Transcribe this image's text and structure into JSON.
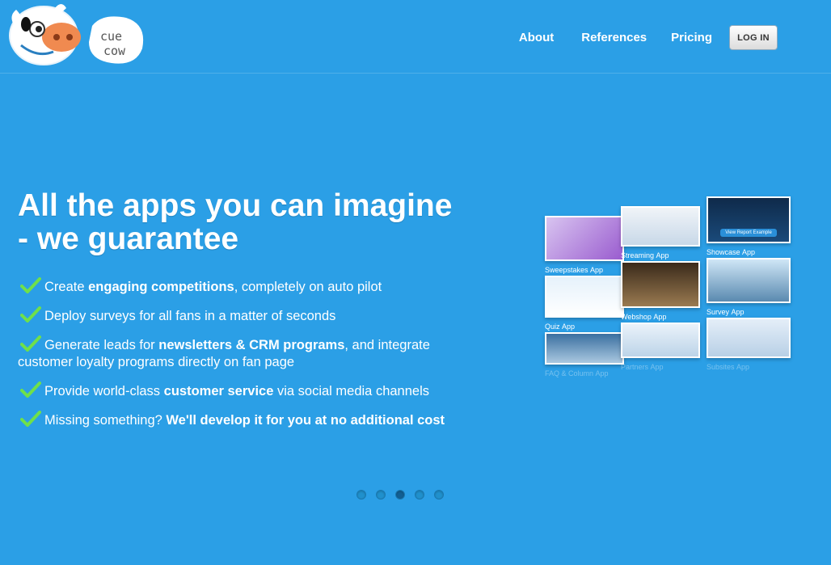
{
  "brand": {
    "logo_text_line1": "cue",
    "logo_text_line2": "cow"
  },
  "nav": {
    "items": [
      "About",
      "References",
      "Pricing"
    ],
    "login_label": "LOG IN"
  },
  "hero": {
    "title_line1": "All the apps you can imagine",
    "title_line2": "- we guarantee",
    "features": [
      {
        "before": "Create ",
        "bold": "engaging competitions",
        "after": ", completely on auto pilot"
      },
      {
        "before": "Deploy surveys for all fans in a matter of seconds",
        "bold": "",
        "after": ""
      },
      {
        "before": "Generate leads for ",
        "bold": "newsletters & CRM programs",
        "after": ", and integrate customer loyalty programs directly on fan page"
      },
      {
        "before": "Provide world-class ",
        "bold": "customer service",
        "after": " via social media channels"
      },
      {
        "before": "Missing something? ",
        "bold": "We'll develop it for you at no additional cost",
        "after": ""
      }
    ]
  },
  "showcase": {
    "apps": [
      {
        "name": "Sweepstakes",
        "suffix": "App"
      },
      {
        "name": "Streaming",
        "suffix": "App"
      },
      {
        "name": "Showcase",
        "suffix": "App"
      },
      {
        "name": "Quiz",
        "suffix": "App"
      },
      {
        "name": "Webshop",
        "suffix": "App"
      },
      {
        "name": "Survey",
        "suffix": "App"
      },
      {
        "name": "FAQ & Column",
        "suffix": "App"
      },
      {
        "name": "Partners",
        "suffix": "App"
      },
      {
        "name": "Subsites",
        "suffix": "App"
      }
    ],
    "button_label": "View Report Example"
  },
  "carousel": {
    "slide_count": 5,
    "active_index": 2
  },
  "colors": {
    "background": "#2b9fe6",
    "check": "#6fe04a"
  }
}
